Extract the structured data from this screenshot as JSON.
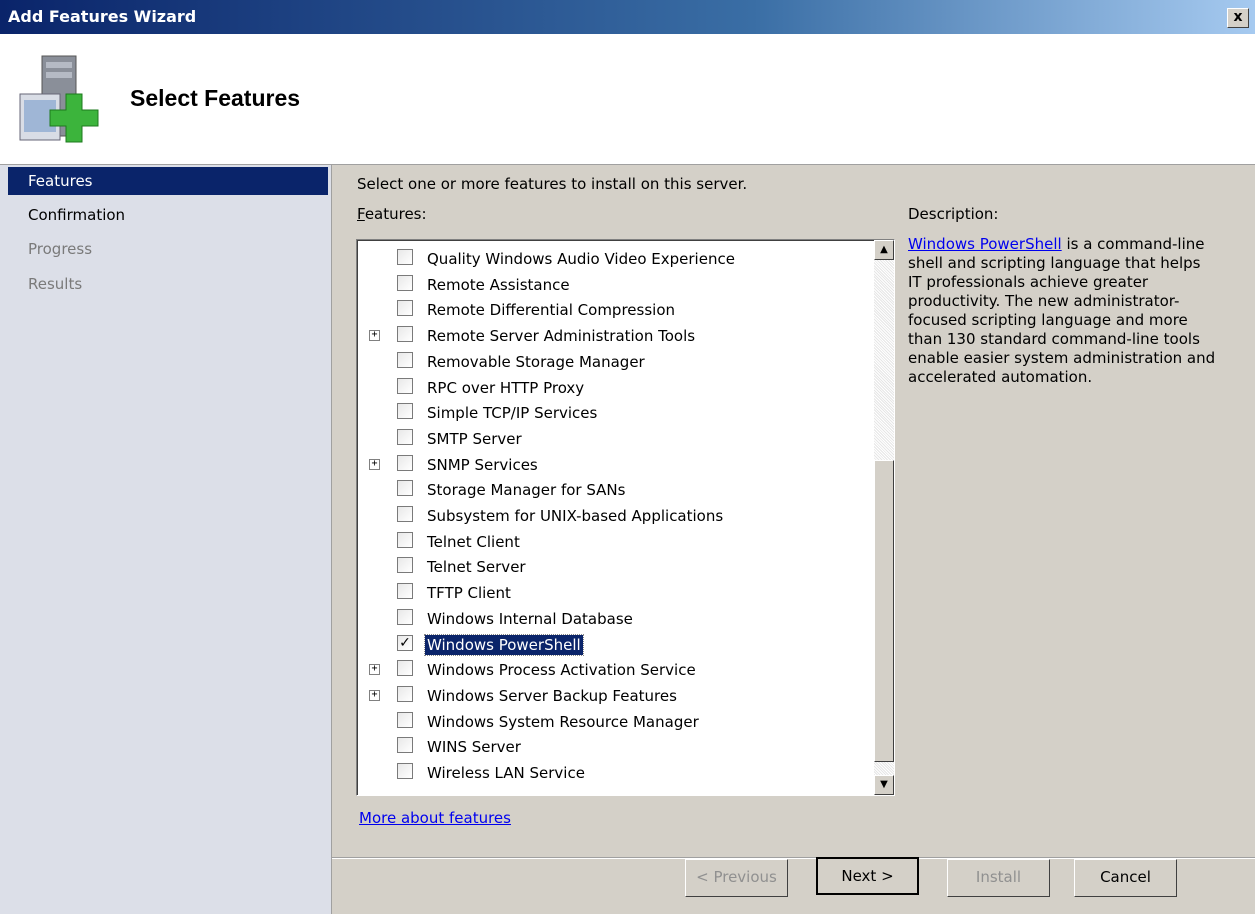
{
  "window": {
    "title": "Add Features Wizard",
    "close_label": "x"
  },
  "header": {
    "title": "Select Features",
    "icon": "server-add-icon"
  },
  "nav": {
    "items": [
      {
        "label": "Features",
        "state": "active"
      },
      {
        "label": "Confirmation",
        "state": "normal"
      },
      {
        "label": "Progress",
        "state": "disabled"
      },
      {
        "label": "Results",
        "state": "disabled"
      }
    ]
  },
  "main": {
    "instruction": "Select one or more features to install on this server.",
    "features_label_first": "F",
    "features_label_rest": "eatures:",
    "description_label": "Description:",
    "description_link": "Windows PowerShell",
    "description_text": " is a command-line shell and scripting language that helps IT professionals achieve greater productivity. The new administrator-focused scripting language and more than 130 standard command-line tools enable easier system administration and accelerated automation.",
    "more_link": "More about features",
    "features": [
      {
        "label": "Quality Windows Audio Video Experience",
        "expandable": false,
        "checked": false
      },
      {
        "label": "Remote Assistance",
        "expandable": false,
        "checked": false
      },
      {
        "label": "Remote Differential Compression",
        "expandable": false,
        "checked": false
      },
      {
        "label": "Remote Server Administration Tools",
        "expandable": true,
        "checked": false
      },
      {
        "label": "Removable Storage Manager",
        "expandable": false,
        "checked": false
      },
      {
        "label": "RPC over HTTP Proxy",
        "expandable": false,
        "checked": false
      },
      {
        "label": "Simple TCP/IP Services",
        "expandable": false,
        "checked": false
      },
      {
        "label": "SMTP Server",
        "expandable": false,
        "checked": false
      },
      {
        "label": "SNMP Services",
        "expandable": true,
        "checked": false
      },
      {
        "label": "Storage Manager for SANs",
        "expandable": false,
        "checked": false
      },
      {
        "label": "Subsystem for UNIX-based Applications",
        "expandable": false,
        "checked": false
      },
      {
        "label": "Telnet Client",
        "expandable": false,
        "checked": false
      },
      {
        "label": "Telnet Server",
        "expandable": false,
        "checked": false
      },
      {
        "label": "TFTP Client",
        "expandable": false,
        "checked": false
      },
      {
        "label": "Windows Internal Database",
        "expandable": false,
        "checked": false
      },
      {
        "label": "Windows PowerShell",
        "expandable": false,
        "checked": true,
        "selected": true
      },
      {
        "label": "Windows Process Activation Service",
        "expandable": true,
        "checked": false
      },
      {
        "label": "Windows Server Backup Features",
        "expandable": true,
        "checked": false
      },
      {
        "label": "Windows System Resource Manager",
        "expandable": false,
        "checked": false
      },
      {
        "label": "WINS Server",
        "expandable": false,
        "checked": false
      },
      {
        "label": "Wireless LAN Service",
        "expandable": false,
        "checked": false
      }
    ]
  },
  "buttons": {
    "previous": "< Previous",
    "next": "Next >",
    "install": "Install",
    "cancel": "Cancel"
  }
}
